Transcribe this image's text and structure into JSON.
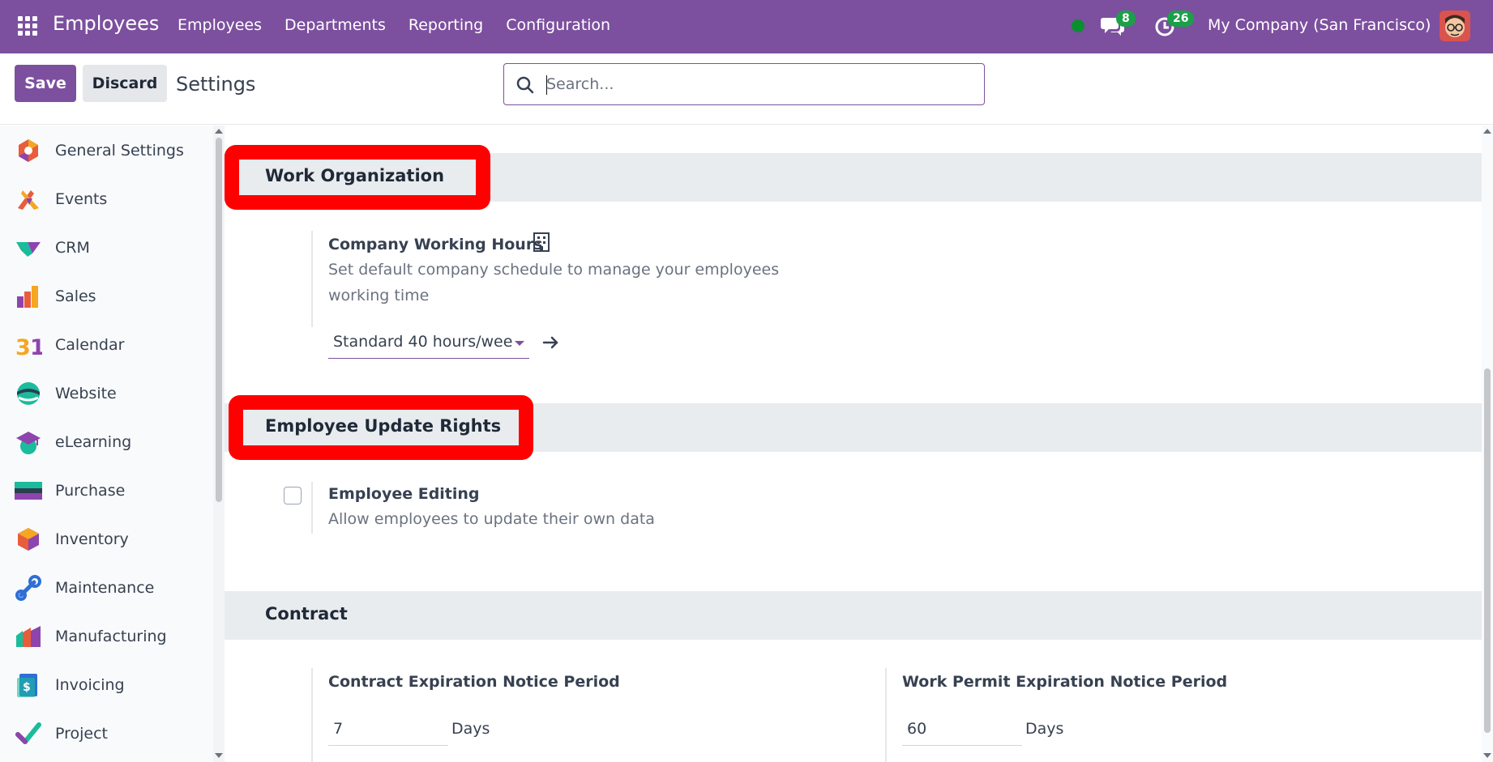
{
  "nav": {
    "app_name": "Employees",
    "menu": [
      "Employees",
      "Departments",
      "Reporting",
      "Configuration"
    ],
    "messages_count": "8",
    "activities_count": "26",
    "company": "My Company (San Francisco)"
  },
  "control": {
    "save_label": "Save",
    "discard_label": "Discard",
    "title": "Settings",
    "search_placeholder": "Search..."
  },
  "sidebar": {
    "items": [
      {
        "label": "General Settings",
        "icon": "general-settings-icon"
      },
      {
        "label": "Events",
        "icon": "events-icon"
      },
      {
        "label": "CRM",
        "icon": "crm-icon"
      },
      {
        "label": "Sales",
        "icon": "sales-icon"
      },
      {
        "label": "Calendar",
        "icon": "calendar-icon"
      },
      {
        "label": "Website",
        "icon": "website-icon"
      },
      {
        "label": "eLearning",
        "icon": "elearning-icon"
      },
      {
        "label": "Purchase",
        "icon": "purchase-icon"
      },
      {
        "label": "Inventory",
        "icon": "inventory-icon"
      },
      {
        "label": "Maintenance",
        "icon": "maintenance-icon"
      },
      {
        "label": "Manufacturing",
        "icon": "manufacturing-icon"
      },
      {
        "label": "Invoicing",
        "icon": "invoicing-icon"
      },
      {
        "label": "Project",
        "icon": "project-icon"
      }
    ]
  },
  "sections": {
    "work_org": {
      "title": "Work Organization",
      "setting_title": "Company Working Hours",
      "setting_desc_line1": "Set default company schedule to manage your employees",
      "setting_desc_line2": "working time",
      "schedule_value": "Standard 40 hours/wee"
    },
    "update_rights": {
      "title": "Employee Update Rights",
      "setting_title": "Employee Editing",
      "setting_desc": "Allow employees to update their own data",
      "checked": false
    },
    "contract": {
      "title": "Contract",
      "contract_notice_title": "Contract Expiration Notice Period",
      "contract_notice_value": "7",
      "contract_notice_unit": "Days",
      "permit_notice_title": "Work Permit Expiration Notice Period",
      "permit_notice_value": "60",
      "permit_notice_unit": "Days"
    }
  },
  "colors": {
    "brand": "#7c509e",
    "highlight": "#ff0000",
    "badge": "#1aa048",
    "online": "#0a8f2e"
  }
}
